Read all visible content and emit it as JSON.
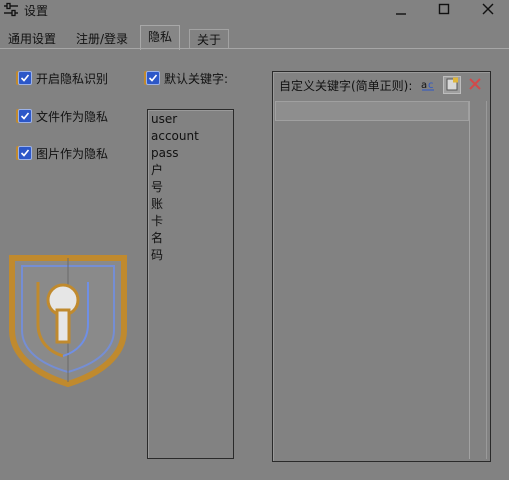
{
  "window": {
    "title": "设置",
    "icon": "sliders-icon",
    "controls": [
      "minimize-icon",
      "maximize-icon",
      "close-icon"
    ]
  },
  "tabs": [
    {
      "label": "通用设置",
      "active": false
    },
    {
      "label": "注册/登录",
      "active": false
    },
    {
      "label": "隐私",
      "active": true
    },
    {
      "label": "关于",
      "active": false
    }
  ],
  "options": {
    "enable_privacy": {
      "label": "开启隐私识别",
      "checked": true
    },
    "files_private": {
      "label": "文件作为隐私",
      "checked": true
    },
    "images_private": {
      "label": "图片作为隐私",
      "checked": true
    },
    "default_keywords": {
      "label": "默认关键字:",
      "checked": true
    }
  },
  "default_keywords": [
    "user",
    "account",
    "pass",
    "户",
    "号",
    "账",
    "卡",
    "名",
    "码"
  ],
  "custom_keywords": {
    "title": "自定义关键字(简单正则):",
    "toolbar_icons": [
      "regex-icon",
      "add-item-icon",
      "delete-icon"
    ]
  },
  "illustration": {
    "icon": "shield-lock-icon"
  },
  "colors": {
    "background": "#828282",
    "checkbox": "#2c57c8",
    "shield_gold": "#c08a2e",
    "shield_blue": "#6f8fe6",
    "delete_red": "#d24a4a"
  }
}
